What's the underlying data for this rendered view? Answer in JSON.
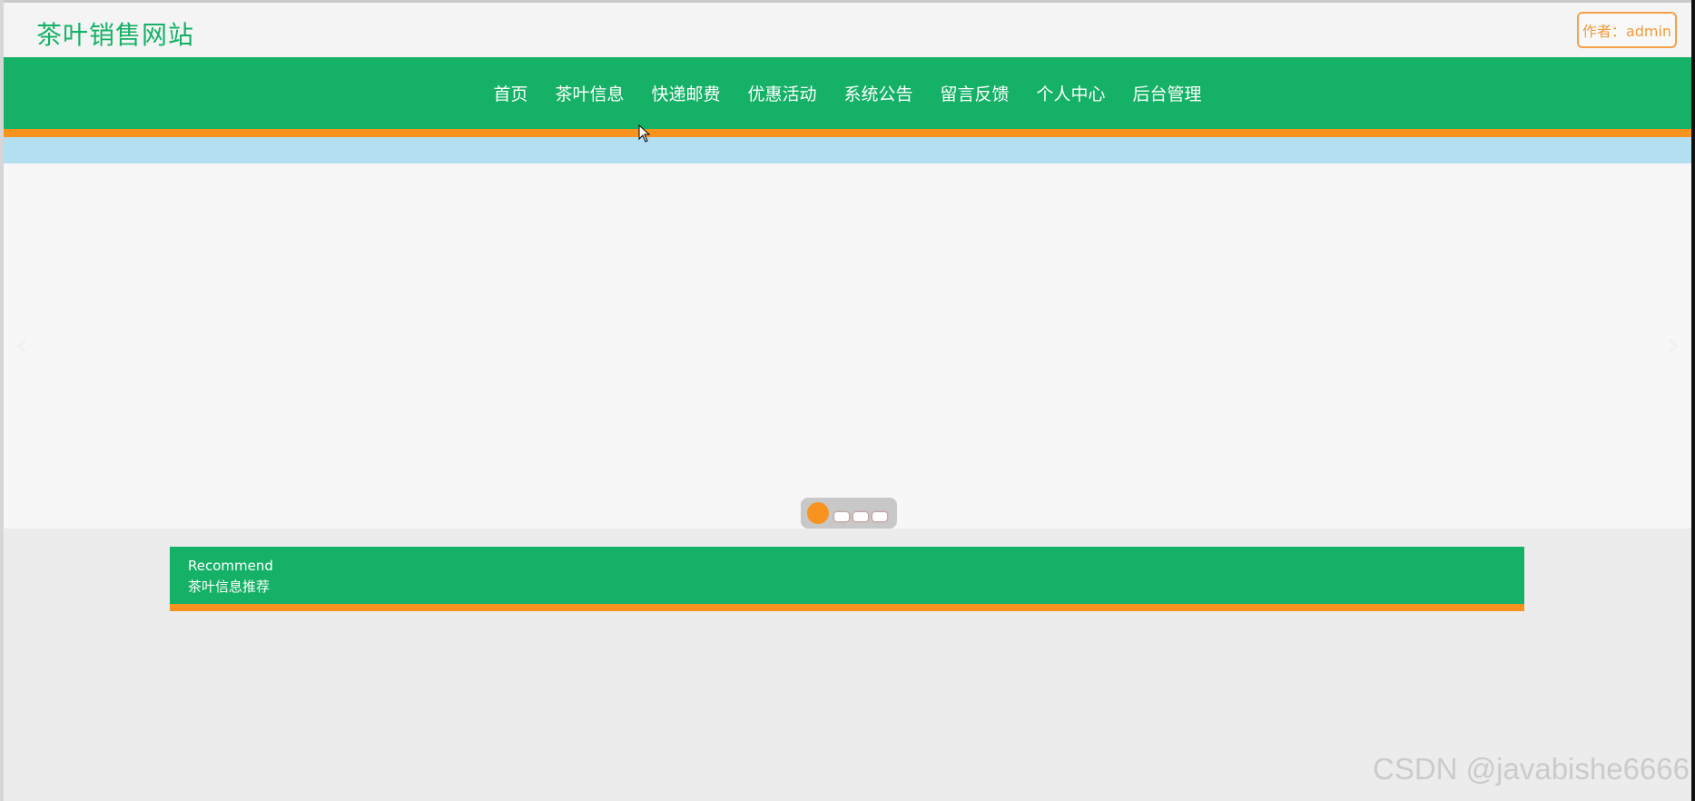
{
  "header": {
    "site_title": "茶叶销售网站",
    "author_label": "作者：admin"
  },
  "nav": {
    "items": [
      {
        "label": "首页"
      },
      {
        "label": "茶叶信息"
      },
      {
        "label": "快递邮费"
      },
      {
        "label": "优惠活动"
      },
      {
        "label": "系统公告"
      },
      {
        "label": "留言反馈"
      },
      {
        "label": "个人中心"
      },
      {
        "label": "后台管理"
      }
    ]
  },
  "carousel": {
    "slide_count": 4,
    "active_index": 0
  },
  "recommend": {
    "title_en": "Recommend",
    "title_cn": "茶叶信息推荐"
  },
  "watermark": "CSDN @javabishe6666",
  "colors": {
    "brand_green": "#14b166",
    "accent_orange": "#f7931e",
    "banner_blue": "#b3dff1"
  }
}
